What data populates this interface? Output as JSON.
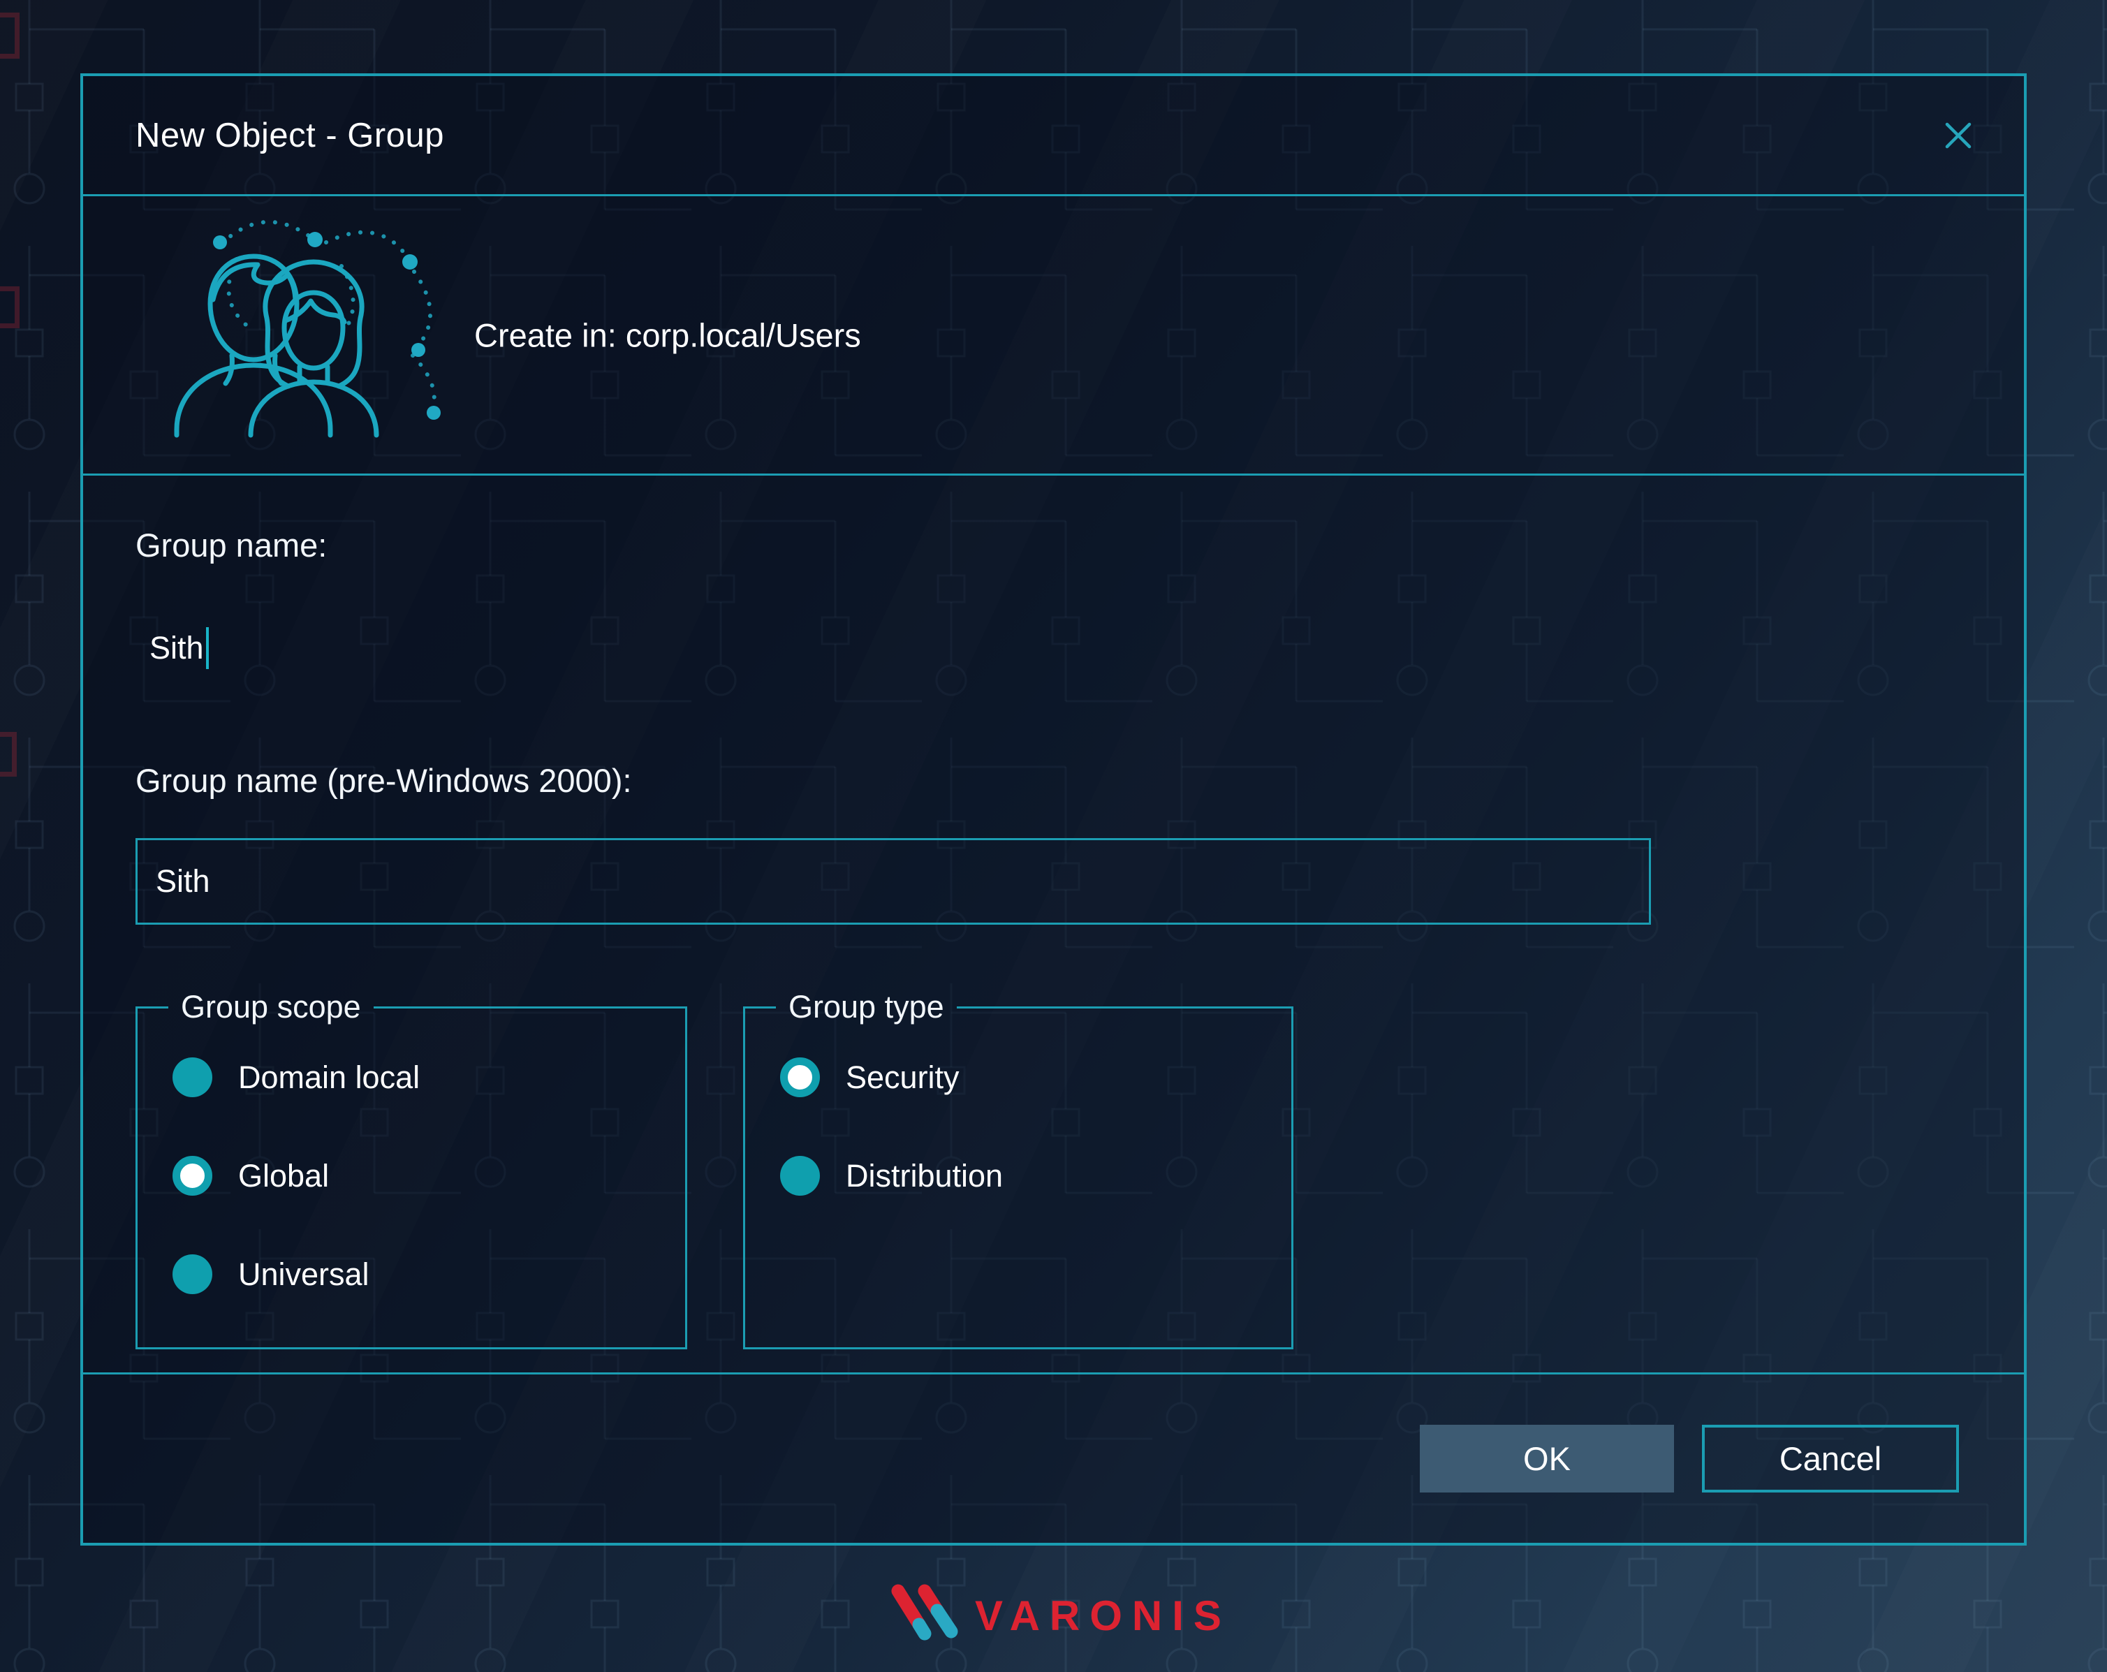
{
  "window": {
    "title": "New Object - Group"
  },
  "header": {
    "create_in": "Create in: corp.local/Users",
    "icon": "group-users-icon"
  },
  "form": {
    "group_name": {
      "label": "Group name:",
      "value": "Sith"
    },
    "group_name_pre2000": {
      "label": "Group name (pre-Windows 2000):",
      "value": "Sith"
    },
    "group_scope": {
      "legend": "Group scope",
      "options": [
        {
          "label": "Domain local",
          "state": "unselected"
        },
        {
          "label": "Global",
          "state": "selected"
        },
        {
          "label": "Universal",
          "state": "unselected"
        }
      ]
    },
    "group_type": {
      "legend": "Group type",
      "options": [
        {
          "label": "Security",
          "state": "selected"
        },
        {
          "label": "Distribution",
          "state": "unselected"
        }
      ]
    }
  },
  "footer": {
    "ok_label": "OK",
    "cancel_label": "Cancel"
  },
  "branding": {
    "logo_text": "VARONIS",
    "brand_red": "#dd2331",
    "brand_teal": "#2aa9c4"
  },
  "colors": {
    "accent_teal": "#1b9db2",
    "radio_teal": "#0f9fae",
    "ok_button_fill": "#3d5b73",
    "dialog_background": "#0c1626",
    "text": "#ffffff"
  }
}
